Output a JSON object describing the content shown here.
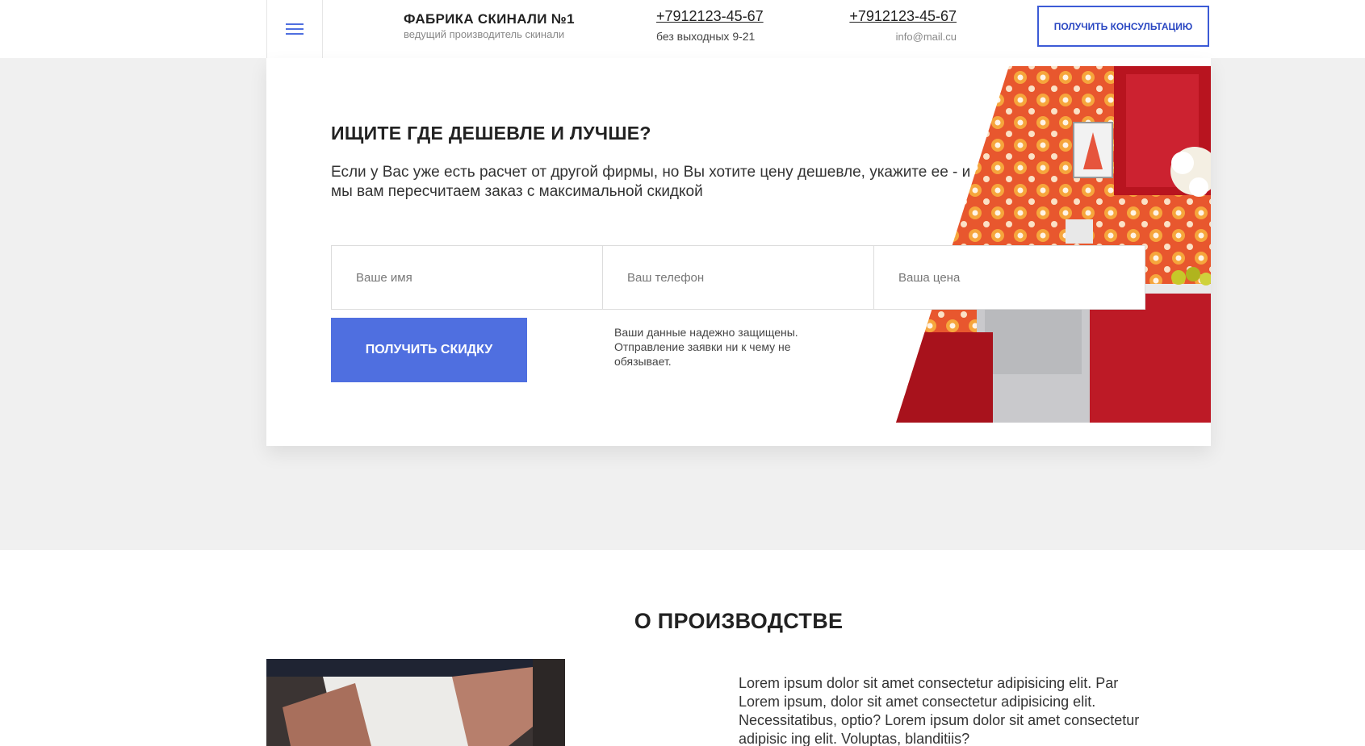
{
  "header": {
    "brand_title": "ФАБРИКА СКИНАЛИ №1",
    "brand_subtitle": "ведущий производитель скинали",
    "phone1": "+7912123-45-67",
    "phone1_note": "без выходных 9-21",
    "phone2": "+7912123-45-67",
    "email": "info@mail.cu",
    "consult_button": "ПОЛУЧИТЬ КОНСУЛЬТАЦИЮ"
  },
  "offer": {
    "title": "ИЩИТЕ ГДЕ ДЕШЕВЛЕ И ЛУЧШЕ?",
    "text": "Если у Вас уже есть расчет от другой фирмы, но Вы хотите цену дешевле, укажите ее - и мы вам пересчитаем заказ с максимальной скидкой",
    "name_placeholder": "Ваше имя",
    "phone_placeholder": "Ваш телефон",
    "price_placeholder": "Ваша цена",
    "submit_button": "ПОЛУЧИТЬ СКИДКУ",
    "privacy_text": "Ваши данные надежно защищены. Отправление заявки ни к чему не обязывает."
  },
  "about": {
    "title": "О ПРОИЗВОДСТВЕ",
    "text": "Lorem ipsum dolor sit amet consectetur adipisicing elit. Par Lorem ipsum, dolor sit amet consectetur adipisicing elit. Necessitatibus, optio? Lorem ipsum dolor sit amet consectetur adipisic ing elit. Voluptas, blanditiis?"
  },
  "colors": {
    "accent": "#4f6fe0",
    "accent_dark": "#2a47c2",
    "page_bg": "#f0f0f0"
  },
  "icons": {
    "menu": "menu-icon"
  }
}
